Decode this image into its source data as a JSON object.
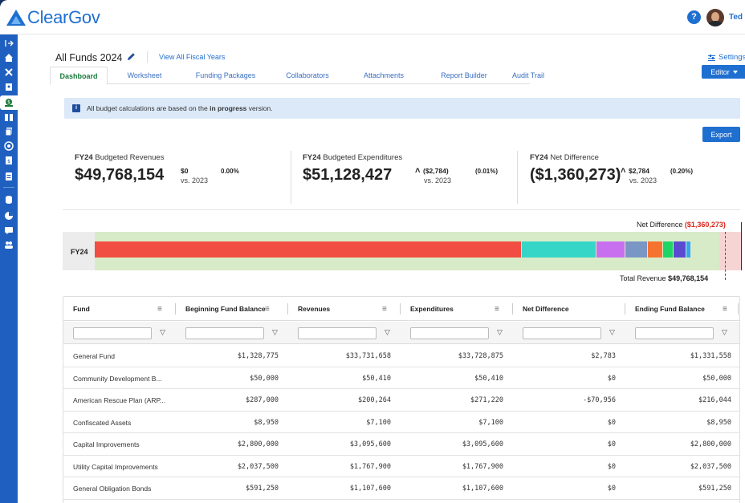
{
  "app": {
    "logo_text": "ClearGov",
    "help_label": "?",
    "user_name": "Ted"
  },
  "sidebar": {
    "items": [
      {
        "icon": "expand-arrow-icon",
        "active": false
      },
      {
        "icon": "home-icon",
        "active": false
      },
      {
        "icon": "tools-icon",
        "active": false
      },
      {
        "icon": "clipboard-user-icon",
        "active": false
      },
      {
        "icon": "budget-dollar-icon",
        "active": true
      },
      {
        "icon": "book-open-icon",
        "active": false
      },
      {
        "icon": "copy-icon",
        "active": false
      },
      {
        "icon": "target-icon",
        "active": false
      },
      {
        "icon": "document-dollar-icon",
        "active": false
      },
      {
        "icon": "form-icon",
        "active": false
      },
      {
        "icon": "database-icon",
        "active": false
      },
      {
        "icon": "pie-chart-icon",
        "active": false
      },
      {
        "icon": "chat-icon",
        "active": false
      },
      {
        "icon": "users-icon",
        "active": false
      }
    ]
  },
  "page": {
    "title": "All Funds 2024",
    "view_all": "View All Fiscal Years",
    "settings": "Settings",
    "editor": "Editor",
    "export": "Export"
  },
  "tabs": [
    {
      "label": "Dashboard",
      "active": true
    },
    {
      "label": "Worksheet",
      "active": false
    },
    {
      "label": "Funding Packages",
      "active": false
    },
    {
      "label": "Collaborators",
      "active": false
    },
    {
      "label": "Attachments",
      "active": false
    },
    {
      "label": "Report Builder",
      "active": false
    },
    {
      "label": "Audit Trail",
      "active": false
    }
  ],
  "info": {
    "icon": "i",
    "before": "All budget calculations are based on the ",
    "bold": "in progress",
    "after": " version."
  },
  "kpis": [
    {
      "prefix": "FY24",
      "label": " Budgeted Revenues",
      "value": "$49,768,154",
      "delta": "$0",
      "vs": "vs. 2023",
      "pct": "0.00%",
      "arrow": ""
    },
    {
      "prefix": "FY24",
      "label": " Budgeted Expenditures",
      "value": "$51,128,427",
      "delta": "($2,784)",
      "vs": "vs. 2023",
      "pct": "(0.01%)",
      "arrow": "˄"
    },
    {
      "prefix": "FY24",
      "label": " Net Difference",
      "value": "($1,360,273)",
      "delta": "$2,784",
      "vs": "vs. 2023",
      "pct": "(0.20%)",
      "arrow": "˄"
    }
  ],
  "chart_data": {
    "type": "bar",
    "orientation": "horizontal-stacked",
    "categories": [
      "FY24"
    ],
    "total_label": "Total Revenue",
    "total_value": "$49,768,154",
    "total": 49768154,
    "net_label": "Net Difference",
    "net_value": "($1,360,273)",
    "net": -1360273,
    "stack_total": 51128427,
    "segments": [
      {
        "value": 33728875,
        "color": "#f24d42"
      },
      {
        "value": 5900000,
        "color": "#35d6c8"
      },
      {
        "value": 2300000,
        "color": "#c86ff0"
      },
      {
        "value": 1800000,
        "color": "#7a96c4"
      },
      {
        "value": 1200000,
        "color": "#f5732e"
      },
      {
        "value": 800000,
        "color": "#1fd466"
      },
      {
        "value": 1000000,
        "color": "#5b4ad0"
      },
      {
        "value": 400000,
        "color": "#36a6f2"
      }
    ]
  },
  "table": {
    "columns": [
      "Fund",
      "Beginning Fund Balance",
      "Revenues",
      "Expenditures",
      "Net Difference",
      "Ending Fund Balance"
    ],
    "rows": [
      [
        "General Fund",
        "$1,328,775",
        "$33,731,658",
        "$33,728,875",
        "$2,783",
        "$1,331,558"
      ],
      [
        "Community Development B...",
        "$50,000",
        "$50,410",
        "$50,410",
        "$0",
        "$50,000"
      ],
      [
        "American Rescue Plan (ARP...",
        "$287,000",
        "$200,264",
        "$271,220",
        "-$70,956",
        "$216,044"
      ],
      [
        "Confiscated Assets",
        "$8,950",
        "$7,100",
        "$7,100",
        "$0",
        "$8,950"
      ],
      [
        "Capital Improvements",
        "$2,800,000",
        "$3,095,600",
        "$3,095,600",
        "$0",
        "$2,800,000"
      ],
      [
        "Utility Capital Improvements",
        "$2,037,500",
        "$1,767,900",
        "$1,767,900",
        "$0",
        "$2,037,500"
      ],
      [
        "General Obligation Bonds",
        "$591,250",
        "$1,107,600",
        "$1,107,600",
        "$0",
        "$591,250"
      ]
    ]
  },
  "colors": {
    "brand": "#1f6fd1",
    "sidebar": "#1f5fbf",
    "active_tab": "#1a7a3a",
    "negative": "#d9261c"
  }
}
